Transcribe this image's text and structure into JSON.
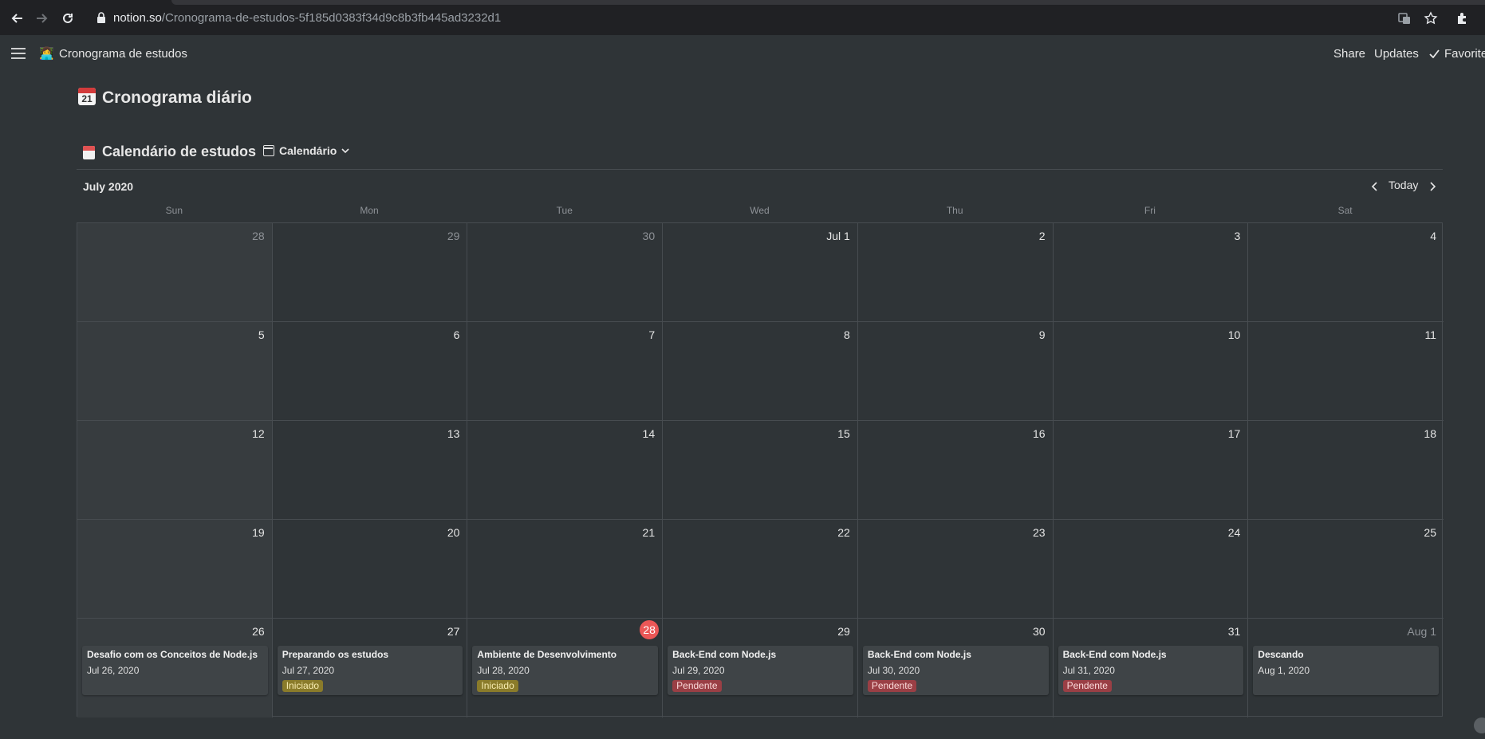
{
  "browser": {
    "url_host": "notion.so",
    "url_path": "/Cronograma-de-estudos-5f185d0383f34d9c8b3fb445ad3232d1"
  },
  "topbar": {
    "breadcrumb_emoji": "👩‍💻",
    "breadcrumb": "Cronograma de estudos",
    "share": "Share",
    "updates": "Updates",
    "favorite": "Favorite"
  },
  "page": {
    "title": "Cronograma diário",
    "title_emoji_number": "21"
  },
  "database": {
    "title": "Calendário de estudos",
    "view": "Calendário"
  },
  "calendar": {
    "month": "July 2020",
    "today_label": "Today",
    "weekdays": [
      "Sun",
      "Mon",
      "Tue",
      "Wed",
      "Thu",
      "Fri",
      "Sat"
    ],
    "weeks": [
      [
        "28",
        "29",
        "30",
        "Jul 1",
        "2",
        "3",
        "4"
      ],
      [
        "5",
        "6",
        "7",
        "8",
        "9",
        "10",
        "11"
      ],
      [
        "12",
        "13",
        "14",
        "15",
        "16",
        "17",
        "18"
      ],
      [
        "19",
        "20",
        "21",
        "22",
        "23",
        "24",
        "25"
      ],
      [
        "26",
        "27",
        "28",
        "29",
        "30",
        "31",
        "Aug 1"
      ]
    ],
    "dim_days": [
      [
        0,
        0
      ],
      [
        0,
        1
      ],
      [
        0,
        2
      ],
      [
        4,
        6
      ]
    ],
    "today_cell": [
      4,
      2
    ],
    "events": [
      {
        "col": 0,
        "title": "Desafio com os Conceitos de Node.js",
        "date": "Jul 26, 2020",
        "status": ""
      },
      {
        "col": 1,
        "title": "Preparando os estudos",
        "date": "Jul 27, 2020",
        "status": "Iniciado"
      },
      {
        "col": 2,
        "title": "Ambiente de Desenvolvimento",
        "date": "Jul 28, 2020",
        "status": "Iniciado"
      },
      {
        "col": 3,
        "title": "Back-End com Node.js",
        "date": "Jul 29, 2020",
        "status": "Pendente"
      },
      {
        "col": 4,
        "title": "Back-End com Node.js",
        "date": "Jul 30, 2020",
        "status": "Pendente"
      },
      {
        "col": 5,
        "title": "Back-End com Node.js",
        "date": "Jul 31, 2020",
        "status": "Pendente"
      },
      {
        "col": 6,
        "title": "Descando",
        "date": "Aug 1, 2020",
        "status": ""
      }
    ]
  },
  "colors": {
    "background": "#2f3437",
    "today": "#eb5757",
    "tag_iniciado": "#8a7b2a",
    "tag_pendente": "#9a3f45"
  }
}
